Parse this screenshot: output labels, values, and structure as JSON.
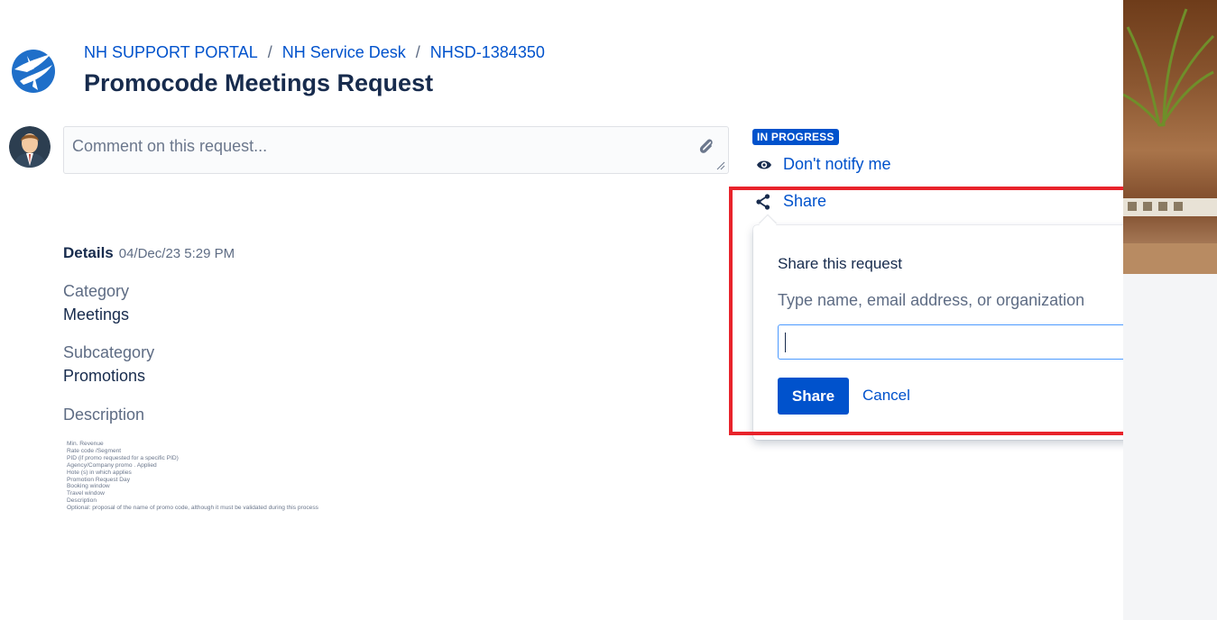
{
  "breadcrumb": {
    "portal": "NH SUPPORT PORTAL",
    "desk": "NH Service Desk",
    "issue": "NHSD-1384350",
    "separator": "/"
  },
  "page_title": "Promocode Meetings Request",
  "comment": {
    "placeholder": "Comment on this request..."
  },
  "details": {
    "label": "Details",
    "date": "04/Dec/23 5:29 PM",
    "fields": [
      {
        "label": "Category",
        "value": "Meetings"
      },
      {
        "label": "Subcategory",
        "value": "Promotions"
      },
      {
        "label": "Description",
        "value": ""
      }
    ],
    "description_image_lines": [
      "Min. Revenue",
      "Rate code /Segment",
      "PID (if promo requested for a specific PID)",
      "Agency/Company promo . Applied",
      "Hote (s) in which applies",
      "Promotion Request Day",
      "Booking window",
      "Travel window",
      "Description",
      "Optional: proposal of the name of promo code, although it must be validated during this process"
    ]
  },
  "sidebar": {
    "status": "IN PROGRESS",
    "notify_label": "Don't notify me",
    "share_label": "Share"
  },
  "share_popup": {
    "title": "Share this request",
    "hint": "Type name, email address, or organization",
    "input_value": "",
    "share_button": "Share",
    "cancel_link": "Cancel"
  },
  "colors": {
    "brand_blue": "#0052cc",
    "highlight_red": "#e8232b",
    "text_dark": "#172b4d",
    "text_muted": "#5e6c84"
  },
  "icons": [
    "portal-logo-icon",
    "user-avatar-icon",
    "attachment-icon",
    "eye-icon",
    "share-icon",
    "chevron-down-icon"
  ]
}
